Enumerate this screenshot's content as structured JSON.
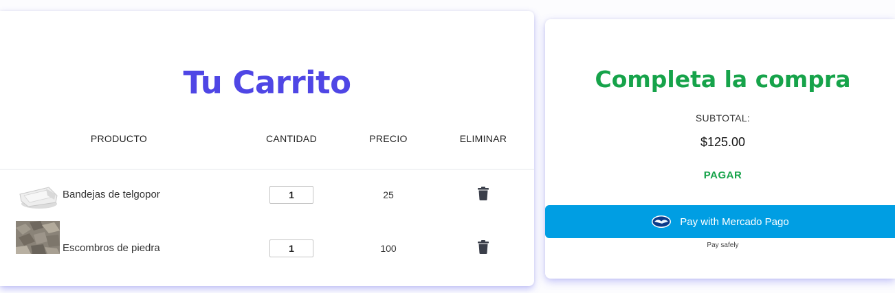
{
  "cart": {
    "title": "Tu Carrito",
    "columns": [
      "PRODUCTO",
      "CANTIDAD",
      "PRECIO",
      "ELIMINAR"
    ],
    "items": [
      {
        "name": "Bandejas de telgopor",
        "quantity": "1",
        "price": "25",
        "image": "styrofoam-tray-photo"
      },
      {
        "name": "Escombros de piedra",
        "quantity": "1",
        "price": "100",
        "image": "stone-rubble-photo"
      }
    ],
    "delete_icon": "trash-icon"
  },
  "checkout": {
    "title": "Completa la compra",
    "subtotal_label": "SUBTOTAL:",
    "subtotal_value": "$125.00",
    "pay_label": "PAGAR",
    "mp_button_label": "Pay with Mercado Pago",
    "mp_icon": "handshake-icon",
    "pay_safely": "Pay safely"
  },
  "colors": {
    "cart_title": "#4f46e5",
    "checkout_accent": "#16a34a",
    "mercado_pago_blue": "#009ee3"
  }
}
